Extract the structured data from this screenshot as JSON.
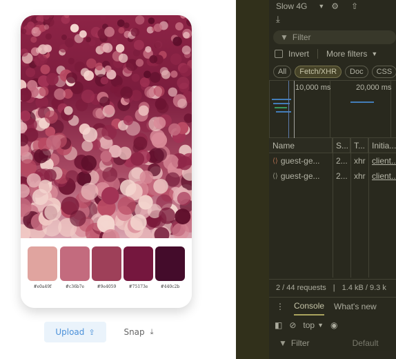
{
  "app": {
    "palette": [
      {
        "hex": "#e0a49f",
        "color": "#e0a49f"
      },
      {
        "hex": "#c36b7e",
        "color": "#c36b7e"
      },
      {
        "hex": "#9e4059",
        "color": "#9e4059"
      },
      {
        "hex": "#75173e",
        "color": "#75173e"
      },
      {
        "hex": "#440c2b",
        "color": "#440c2b"
      }
    ],
    "upload_label": "Upload",
    "upload_icon": "upload-icon",
    "snap_label": "Snap",
    "snap_icon": "download-icon"
  },
  "devtools": {
    "throttle": "Slow 4G",
    "filter_placeholder": "Filter",
    "invert_label": "Invert",
    "more_filters_label": "More filters",
    "type_filters": [
      "All",
      "Fetch/XHR",
      "Doc",
      "CSS"
    ],
    "active_type": "Fetch/XHR",
    "timeline_ticks": [
      "10,000 ms",
      "20,000 ms"
    ],
    "columns": [
      "Name",
      "S...",
      "T...",
      "Initia..."
    ],
    "requests": [
      {
        "name": "guest-ge...",
        "status": "2...",
        "type": "xhr",
        "initiator": "client..."
      },
      {
        "name": "guest-ge...",
        "status": "2...",
        "type": "xhr",
        "initiator": "client..."
      }
    ],
    "status_requests": "2 / 44 requests",
    "status_transferred": "1.4 kB / 9.3 k",
    "drawer_tabs": [
      "Console",
      "What's new"
    ],
    "active_drawer_tab": "Console",
    "context": "top",
    "console_filter_placeholder": "Filter",
    "default_levels": "Default"
  }
}
